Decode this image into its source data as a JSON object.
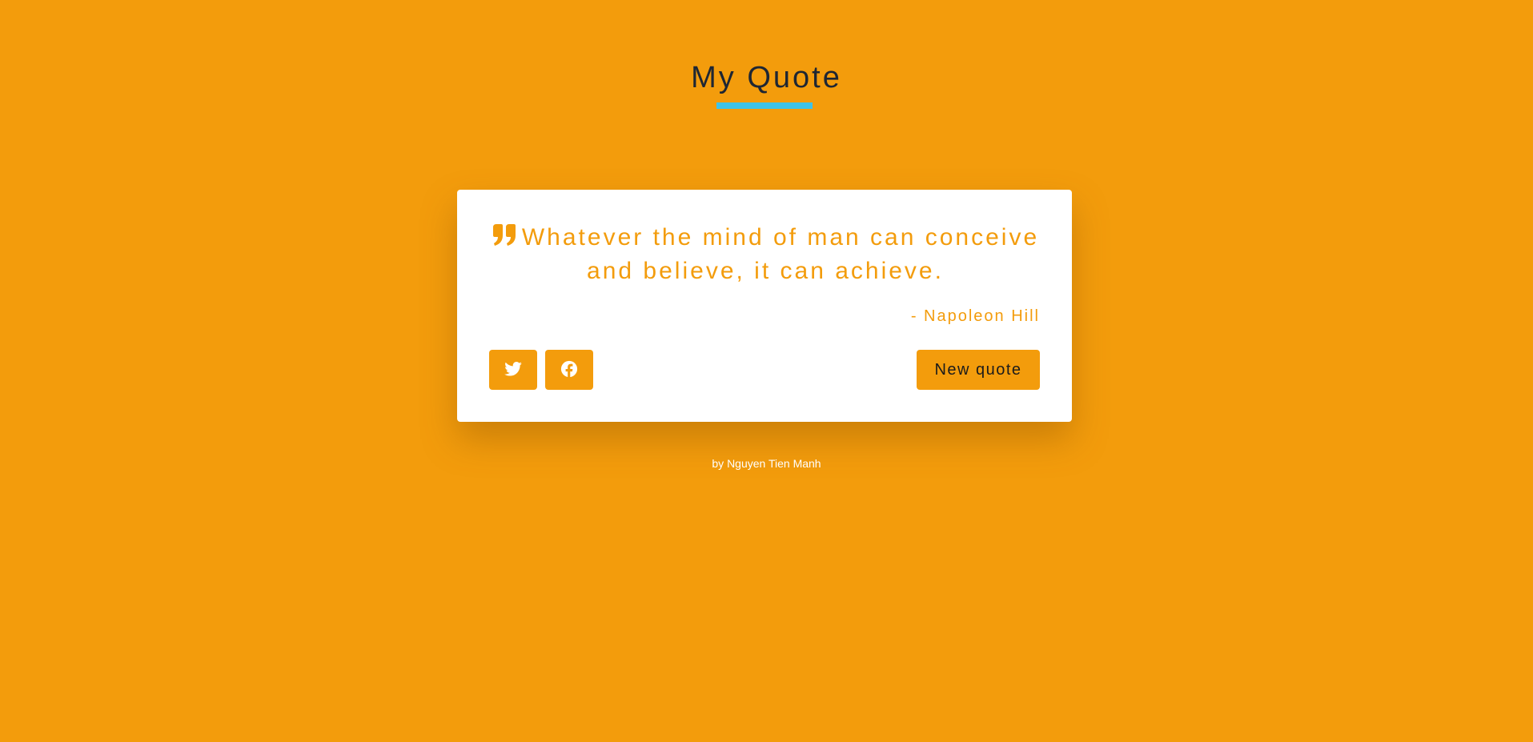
{
  "header": {
    "title": "My Quote"
  },
  "quote": {
    "text": "Whatever the mind of man can conceive and believe, it can achieve.",
    "author": "- Napoleon Hill"
  },
  "actions": {
    "twitter_icon": "twitter-icon",
    "facebook_icon": "facebook-icon",
    "new_quote_label": "New quote"
  },
  "footer": {
    "credit": "by Nguyen Tien Manh"
  },
  "colors": {
    "background": "#f39c0c",
    "accent": "#3fc3e8",
    "card": "#ffffff",
    "title_text": "#1e2633"
  }
}
